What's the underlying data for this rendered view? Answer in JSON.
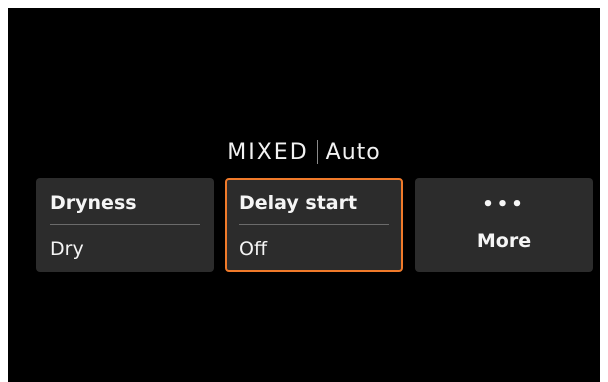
{
  "header": {
    "fabric": "MIXED",
    "cycle": "Auto"
  },
  "tiles": [
    {
      "label": "Dryness",
      "value": "Dry"
    },
    {
      "label": "Delay start",
      "value": "Off",
      "selected": true
    },
    {
      "icon": "ellipsis-icon",
      "label": "More"
    }
  ],
  "colors": {
    "background": "#000000",
    "tile": "#2c2c2c",
    "accent": "#f07a2a"
  }
}
